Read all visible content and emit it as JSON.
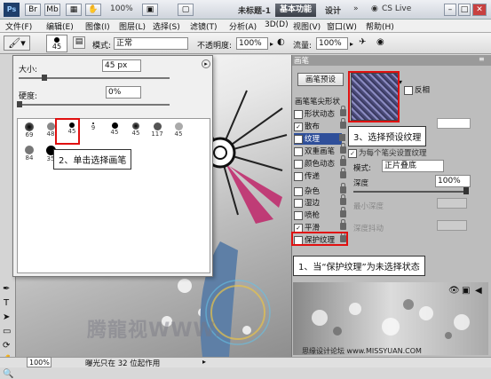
{
  "titlebar": {
    "app_logo": "Ps",
    "zoom": "100%",
    "doc_title": "未标题-1",
    "workspace_basic": "基本功能",
    "workspace_design": "设计",
    "more": "»",
    "cs_live": "CS Live"
  },
  "menu": [
    "文件(F)",
    "编辑(E)",
    "图像(I)",
    "图层(L)",
    "选择(S)",
    "滤镜(T)",
    "分析(A)",
    "3D(D)",
    "视图(V)",
    "窗口(W)",
    "帮助(H)"
  ],
  "options": {
    "brush_size": "45",
    "mode_label": "模式:",
    "mode_value": "正常",
    "opacity_label": "不透明度:",
    "opacity_value": "100%",
    "flow_label": "流量:",
    "flow_value": "100%"
  },
  "brush_picker": {
    "size_label": "大小:",
    "size_value": "45 px",
    "hardness_label": "硬度:",
    "hardness_value": "0%",
    "thumbs_row1": [
      "69",
      "48",
      "45",
      "9",
      "45",
      "45",
      "117",
      "45"
    ],
    "thumbs_row2": [
      "84",
      "35",
      "",
      "",
      "",
      "",
      "",
      ""
    ]
  },
  "brush_panel": {
    "tab": "画笔",
    "preset_button": "画笔预设",
    "tip_shape": "画笔笔尖形状",
    "options": [
      {
        "label": "形状动态",
        "checked": false
      },
      {
        "label": "散布",
        "checked": true
      },
      {
        "label": "纹理",
        "checked": true
      },
      {
        "label": "双重画笔",
        "checked": false
      },
      {
        "label": "颜色动态",
        "checked": false
      },
      {
        "label": "传递",
        "checked": false
      },
      {
        "label": "杂色",
        "checked": false
      },
      {
        "label": "湿边",
        "checked": false
      },
      {
        "label": "喷枪",
        "checked": false
      },
      {
        "label": "平滑",
        "checked": true
      },
      {
        "label": "保护纹理",
        "checked": false
      }
    ],
    "invert_label": "反相",
    "texture_each_tip": "为每个笔尖设置纹理",
    "mode_label": "模式:",
    "mode_value": "正片叠底",
    "depth_label": "深度",
    "depth_value": "100%",
    "min_depth": "最小深度",
    "depth_jitter": "深度抖动"
  },
  "callouts": {
    "step1": "1、当“保护纹理”为未选择状态",
    "step2": "2、单击选择画笔",
    "step3": "3、选择预设纹理"
  },
  "canvas": {
    "watermark": "腾龍视WWW.",
    "bottom_watermark": "思缘设计论坛 www.MISSYUAN.COM"
  },
  "status": {
    "zoom": "100%",
    "message": "曝光只在 32 位起作用"
  },
  "colors": {
    "accent_red": "#e01010",
    "brand_dark": "#1f3f6b"
  }
}
